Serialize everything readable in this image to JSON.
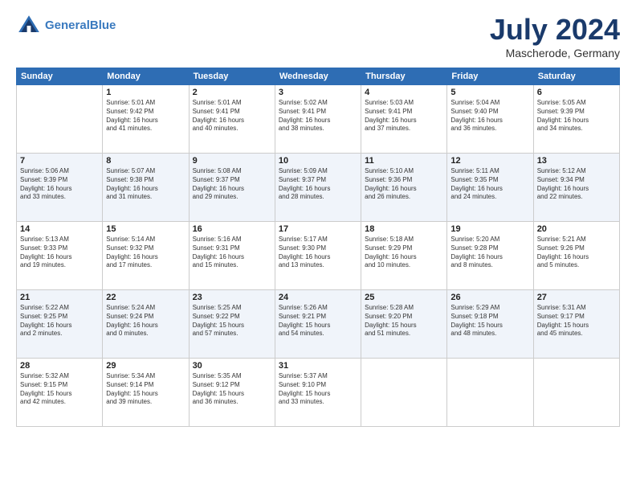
{
  "header": {
    "logo_line1": "General",
    "logo_line2": "Blue",
    "month_title": "July 2024",
    "location": "Mascherode, Germany"
  },
  "days_of_week": [
    "Sunday",
    "Monday",
    "Tuesday",
    "Wednesday",
    "Thursday",
    "Friday",
    "Saturday"
  ],
  "weeks": [
    [
      {
        "day": "",
        "info": ""
      },
      {
        "day": "1",
        "info": "Sunrise: 5:01 AM\nSunset: 9:42 PM\nDaylight: 16 hours\nand 41 minutes."
      },
      {
        "day": "2",
        "info": "Sunrise: 5:01 AM\nSunset: 9:41 PM\nDaylight: 16 hours\nand 40 minutes."
      },
      {
        "day": "3",
        "info": "Sunrise: 5:02 AM\nSunset: 9:41 PM\nDaylight: 16 hours\nand 38 minutes."
      },
      {
        "day": "4",
        "info": "Sunrise: 5:03 AM\nSunset: 9:41 PM\nDaylight: 16 hours\nand 37 minutes."
      },
      {
        "day": "5",
        "info": "Sunrise: 5:04 AM\nSunset: 9:40 PM\nDaylight: 16 hours\nand 36 minutes."
      },
      {
        "day": "6",
        "info": "Sunrise: 5:05 AM\nSunset: 9:39 PM\nDaylight: 16 hours\nand 34 minutes."
      }
    ],
    [
      {
        "day": "7",
        "info": "Sunrise: 5:06 AM\nSunset: 9:39 PM\nDaylight: 16 hours\nand 33 minutes."
      },
      {
        "day": "8",
        "info": "Sunrise: 5:07 AM\nSunset: 9:38 PM\nDaylight: 16 hours\nand 31 minutes."
      },
      {
        "day": "9",
        "info": "Sunrise: 5:08 AM\nSunset: 9:37 PM\nDaylight: 16 hours\nand 29 minutes."
      },
      {
        "day": "10",
        "info": "Sunrise: 5:09 AM\nSunset: 9:37 PM\nDaylight: 16 hours\nand 28 minutes."
      },
      {
        "day": "11",
        "info": "Sunrise: 5:10 AM\nSunset: 9:36 PM\nDaylight: 16 hours\nand 26 minutes."
      },
      {
        "day": "12",
        "info": "Sunrise: 5:11 AM\nSunset: 9:35 PM\nDaylight: 16 hours\nand 24 minutes."
      },
      {
        "day": "13",
        "info": "Sunrise: 5:12 AM\nSunset: 9:34 PM\nDaylight: 16 hours\nand 22 minutes."
      }
    ],
    [
      {
        "day": "14",
        "info": "Sunrise: 5:13 AM\nSunset: 9:33 PM\nDaylight: 16 hours\nand 19 minutes."
      },
      {
        "day": "15",
        "info": "Sunrise: 5:14 AM\nSunset: 9:32 PM\nDaylight: 16 hours\nand 17 minutes."
      },
      {
        "day": "16",
        "info": "Sunrise: 5:16 AM\nSunset: 9:31 PM\nDaylight: 16 hours\nand 15 minutes."
      },
      {
        "day": "17",
        "info": "Sunrise: 5:17 AM\nSunset: 9:30 PM\nDaylight: 16 hours\nand 13 minutes."
      },
      {
        "day": "18",
        "info": "Sunrise: 5:18 AM\nSunset: 9:29 PM\nDaylight: 16 hours\nand 10 minutes."
      },
      {
        "day": "19",
        "info": "Sunrise: 5:20 AM\nSunset: 9:28 PM\nDaylight: 16 hours\nand 8 minutes."
      },
      {
        "day": "20",
        "info": "Sunrise: 5:21 AM\nSunset: 9:26 PM\nDaylight: 16 hours\nand 5 minutes."
      }
    ],
    [
      {
        "day": "21",
        "info": "Sunrise: 5:22 AM\nSunset: 9:25 PM\nDaylight: 16 hours\nand 2 minutes."
      },
      {
        "day": "22",
        "info": "Sunrise: 5:24 AM\nSunset: 9:24 PM\nDaylight: 16 hours\nand 0 minutes."
      },
      {
        "day": "23",
        "info": "Sunrise: 5:25 AM\nSunset: 9:22 PM\nDaylight: 15 hours\nand 57 minutes."
      },
      {
        "day": "24",
        "info": "Sunrise: 5:26 AM\nSunset: 9:21 PM\nDaylight: 15 hours\nand 54 minutes."
      },
      {
        "day": "25",
        "info": "Sunrise: 5:28 AM\nSunset: 9:20 PM\nDaylight: 15 hours\nand 51 minutes."
      },
      {
        "day": "26",
        "info": "Sunrise: 5:29 AM\nSunset: 9:18 PM\nDaylight: 15 hours\nand 48 minutes."
      },
      {
        "day": "27",
        "info": "Sunrise: 5:31 AM\nSunset: 9:17 PM\nDaylight: 15 hours\nand 45 minutes."
      }
    ],
    [
      {
        "day": "28",
        "info": "Sunrise: 5:32 AM\nSunset: 9:15 PM\nDaylight: 15 hours\nand 42 minutes."
      },
      {
        "day": "29",
        "info": "Sunrise: 5:34 AM\nSunset: 9:14 PM\nDaylight: 15 hours\nand 39 minutes."
      },
      {
        "day": "30",
        "info": "Sunrise: 5:35 AM\nSunset: 9:12 PM\nDaylight: 15 hours\nand 36 minutes."
      },
      {
        "day": "31",
        "info": "Sunrise: 5:37 AM\nSunset: 9:10 PM\nDaylight: 15 hours\nand 33 minutes."
      },
      {
        "day": "",
        "info": ""
      },
      {
        "day": "",
        "info": ""
      },
      {
        "day": "",
        "info": ""
      }
    ]
  ]
}
